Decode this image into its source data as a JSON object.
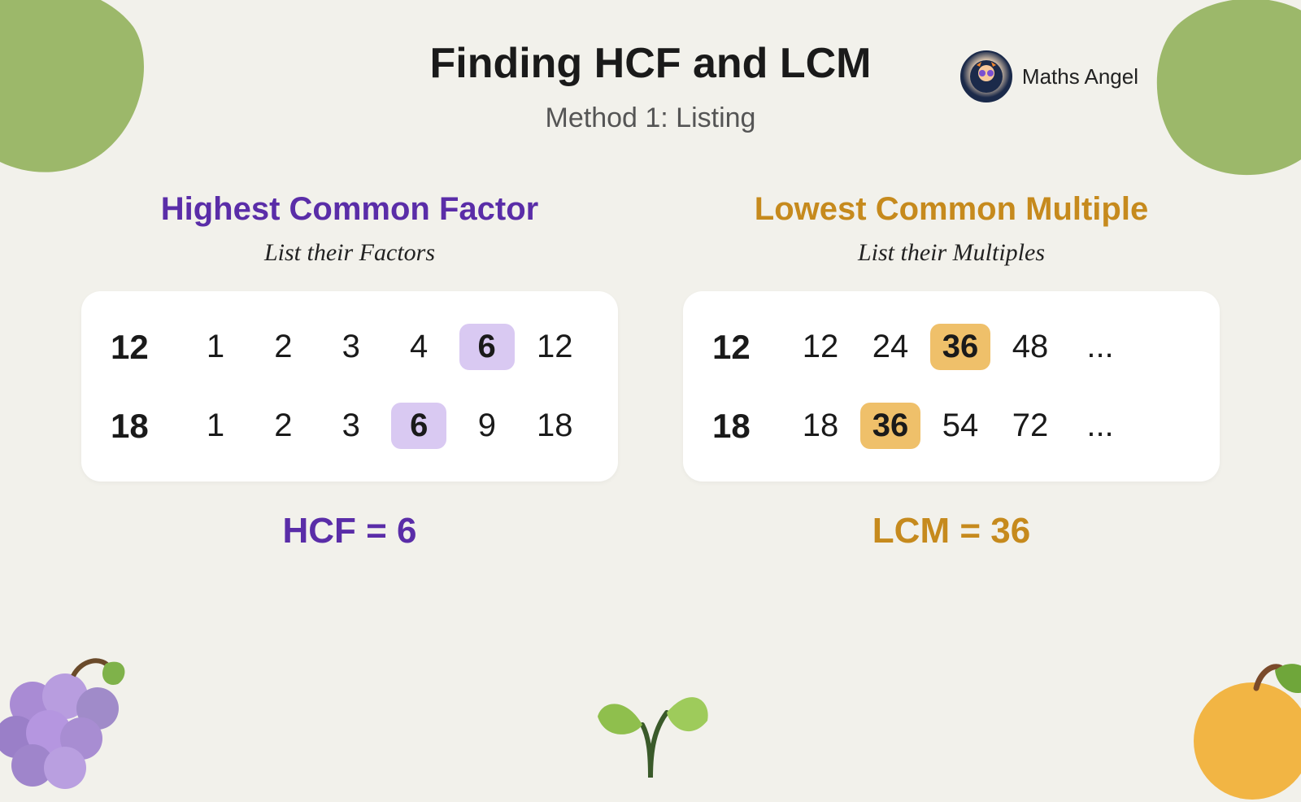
{
  "brand": "Maths Angel",
  "title": "Finding HCF and LCM",
  "subtitle": "Method 1: Listing",
  "hcf": {
    "heading": "Highest Common Factor",
    "sub": "List their Factors",
    "rows": [
      {
        "lead": "12",
        "cells": [
          "1",
          "2",
          "3",
          "4",
          "6",
          "12"
        ],
        "highlight_index": 4
      },
      {
        "lead": "18",
        "cells": [
          "1",
          "2",
          "3",
          "6",
          "9",
          "18"
        ],
        "highlight_index": 3
      }
    ],
    "result": "HCF = 6"
  },
  "lcm": {
    "heading": "Lowest Common Multiple",
    "sub": "List their Multiples",
    "rows": [
      {
        "lead": "12",
        "cells": [
          "12",
          "24",
          "36",
          "48",
          "..."
        ],
        "highlight_index": 2
      },
      {
        "lead": "18",
        "cells": [
          "18",
          "36",
          "54",
          "72",
          "..."
        ],
        "highlight_index": 1
      }
    ],
    "result": "LCM = 36"
  }
}
